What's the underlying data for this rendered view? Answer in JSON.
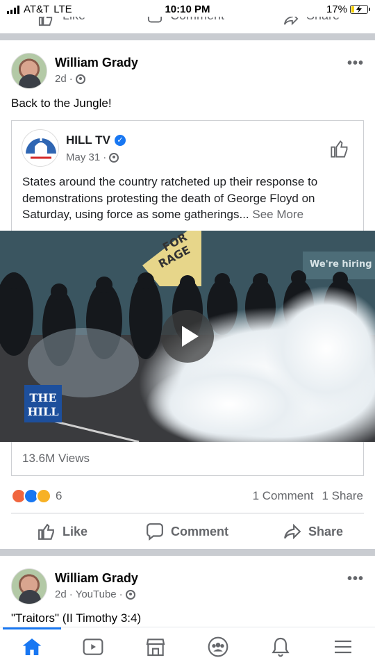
{
  "status_bar": {
    "carrier": "AT&T",
    "network": "LTE",
    "time": "10:10 PM",
    "battery": "17%",
    "battery_level": 0.17
  },
  "prev_post_actions": {
    "like": "Like",
    "comment": "Comment",
    "share": "Share"
  },
  "post1": {
    "author": "William Grady",
    "time": "2d",
    "privacy_icon": "globe-icon",
    "more_label": "•••",
    "text": "Back to the Jungle!",
    "shared": {
      "page_name": "HILL TV",
      "verified": true,
      "date": "May 31",
      "text": "States around the country ratcheted up their response to demonstrations protesting the death of George Floyd on Saturday, using force as some gatherings...",
      "see_more": "See More",
      "video": {
        "watermark_line1": "THE",
        "watermark_line2": "HILL",
        "sign_text_1": "FOR",
        "sign_text_2": "RAGE",
        "banner_text": "We're hiring"
      },
      "views": "13.6M Views"
    },
    "reactions": {
      "icons": [
        "angry-icon",
        "like-reaction-icon",
        "sad-icon"
      ],
      "count": "6"
    },
    "comments": "1 Comment",
    "shares": "1 Share",
    "actions": {
      "like": "Like",
      "comment": "Comment",
      "share": "Share"
    }
  },
  "post2": {
    "author": "William Grady",
    "time": "2d",
    "source": "YouTube",
    "more_label": "•••",
    "text": "\"Traitors\" (II Timothy 3:4)"
  },
  "tabbar": {
    "tabs": [
      "home-icon",
      "watch-icon",
      "marketplace-icon",
      "groups-icon",
      "notifications-icon",
      "menu-icon"
    ],
    "active": "home-icon"
  },
  "colors": {
    "brand_blue": "#1877f2",
    "secondary_text": "#65676b",
    "divider": "#c9ccd1",
    "angry": "#f0663e",
    "sad": "#f7b125"
  }
}
